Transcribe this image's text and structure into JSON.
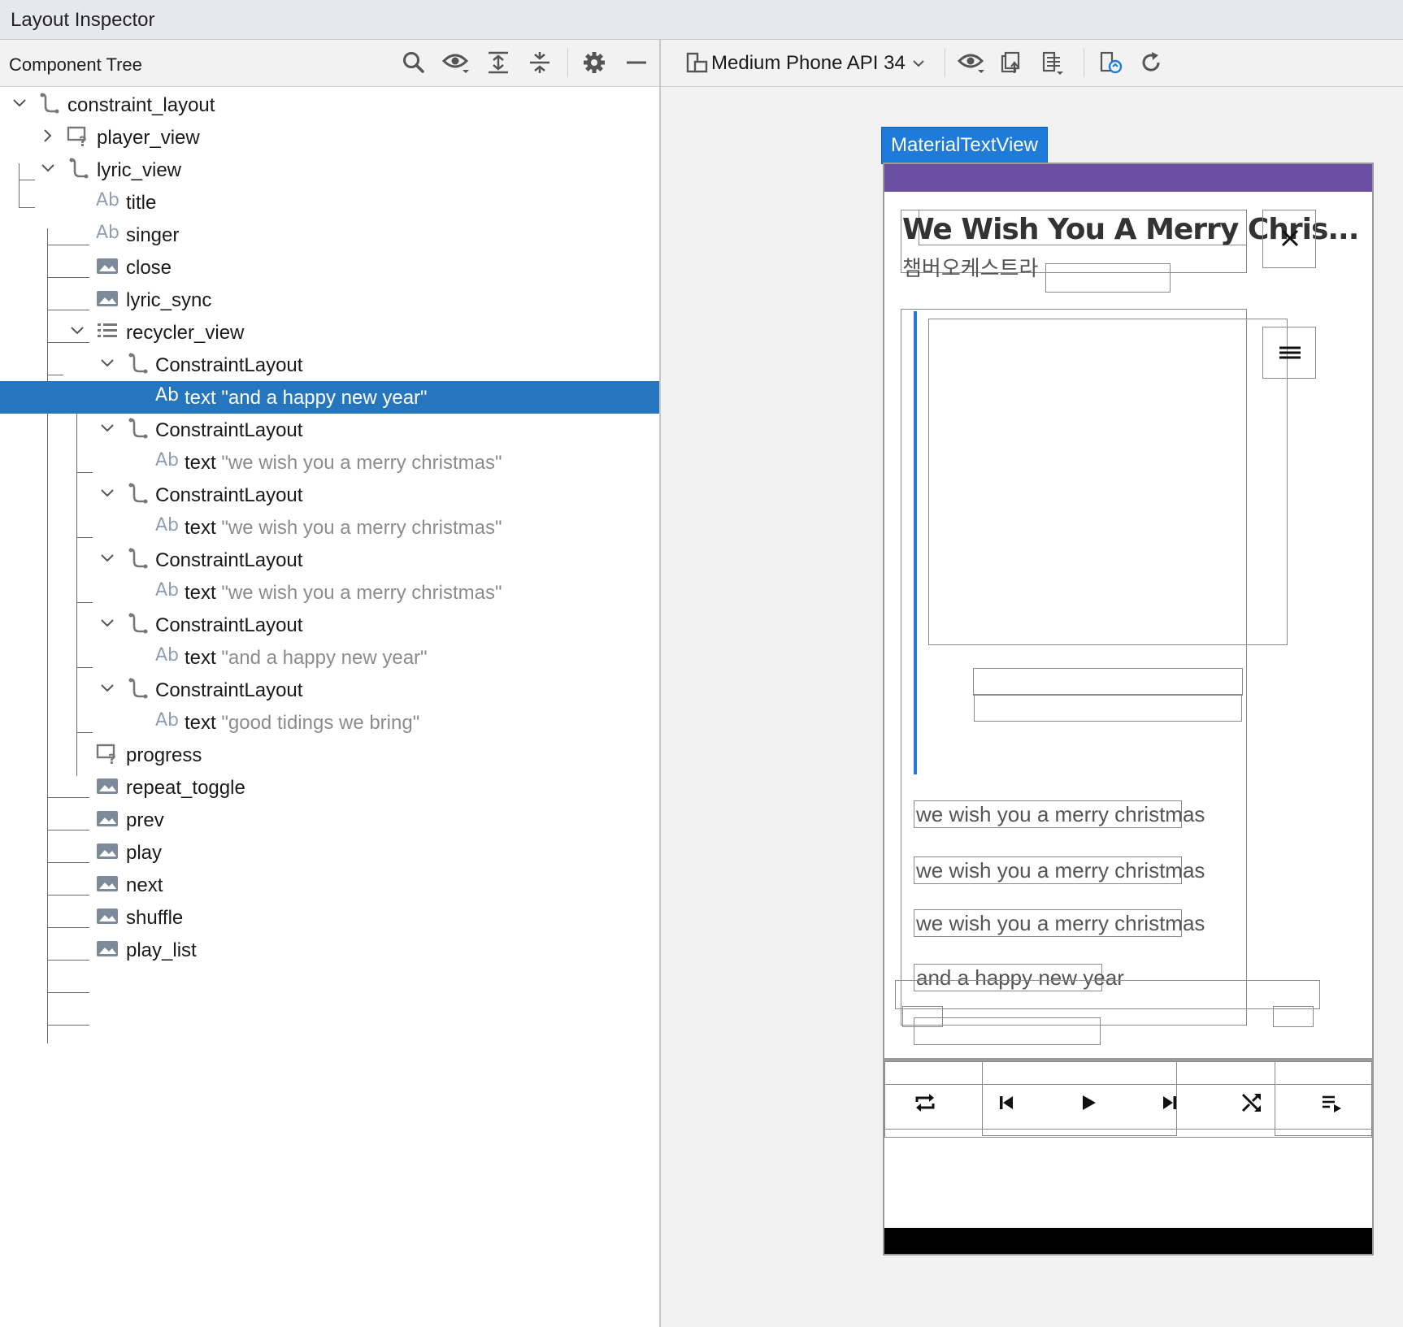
{
  "window": {
    "title": "Layout Inspector"
  },
  "component_tree": {
    "header": "Component Tree",
    "toolbar": [
      "search-icon",
      "eye-icon",
      "expand-all-icon",
      "collapse-all-icon",
      "gear-icon",
      "minimize-icon"
    ],
    "nodes": [
      {
        "label": "constraint_layout",
        "icon": "constraint-layout-icon",
        "expanded": true
      },
      {
        "label": "player_view",
        "icon": "unknown-view-icon",
        "expanded": false
      },
      {
        "label": "lyric_view",
        "icon": "constraint-layout-icon",
        "expanded": true
      },
      {
        "label": "title",
        "icon": "text-view-icon"
      },
      {
        "label": "singer",
        "icon": "text-view-icon"
      },
      {
        "label": "close",
        "icon": "image-view-icon"
      },
      {
        "label": "lyric_sync",
        "icon": "image-view-icon"
      },
      {
        "label": "recycler_view",
        "icon": "list-icon",
        "expanded": true
      },
      {
        "label": "ConstraintLayout",
        "icon": "constraint-layout-icon",
        "expanded": true
      },
      {
        "label": "text",
        "value": "\"and a happy new year\"",
        "icon": "text-view-icon",
        "selected": true
      },
      {
        "label": "ConstraintLayout",
        "icon": "constraint-layout-icon",
        "expanded": true
      },
      {
        "label": "text",
        "value": "\"we wish you a merry christmas\"",
        "icon": "text-view-icon"
      },
      {
        "label": "ConstraintLayout",
        "icon": "constraint-layout-icon",
        "expanded": true
      },
      {
        "label": "text",
        "value": "\"we wish you a merry christmas\"",
        "icon": "text-view-icon"
      },
      {
        "label": "ConstraintLayout",
        "icon": "constraint-layout-icon",
        "expanded": true
      },
      {
        "label": "text",
        "value": "\"we wish you a merry christmas\"",
        "icon": "text-view-icon"
      },
      {
        "label": "ConstraintLayout",
        "icon": "constraint-layout-icon",
        "expanded": true
      },
      {
        "label": "text",
        "value": "\"and a happy new year\"",
        "icon": "text-view-icon"
      },
      {
        "label": "ConstraintLayout",
        "icon": "constraint-layout-icon",
        "expanded": true
      },
      {
        "label": "text",
        "value": "\"good tidings we bring\"",
        "icon": "text-view-icon"
      },
      {
        "label": "progress",
        "icon": "unknown-view-icon"
      },
      {
        "label": "repeat_toggle",
        "icon": "image-view-icon"
      },
      {
        "label": "prev",
        "icon": "image-view-icon"
      },
      {
        "label": "play",
        "icon": "image-view-icon"
      },
      {
        "label": "next",
        "icon": "image-view-icon"
      },
      {
        "label": "shuffle",
        "icon": "image-view-icon"
      },
      {
        "label": "play_list",
        "icon": "image-view-icon"
      }
    ]
  },
  "inspector": {
    "device": "Medium Phone API 34",
    "toolbar": [
      "eye-icon",
      "export-icon",
      "layer-icon",
      "live-update-icon",
      "refresh-icon"
    ],
    "selected_view": "MaterialTextView",
    "ab_glyph": "Ab",
    "preview": {
      "title": "We Wish You A Merry Chris...",
      "singer": "챔버오케스트라",
      "lyrics": [
        "we wish you a merry christmas",
        "we wish you a merry christmas",
        "we wish you a merry christmas",
        "and a happy new year"
      ],
      "controls": [
        "repeat-icon",
        "prev-icon",
        "play-icon",
        "next-icon",
        "shuffle-icon",
        "playlist-icon"
      ]
    }
  },
  "colors": {
    "selection": "#2675bf",
    "appbar": "#6a4fa3",
    "tag": "#1e7bd9",
    "sync_line": "#2979d8"
  }
}
